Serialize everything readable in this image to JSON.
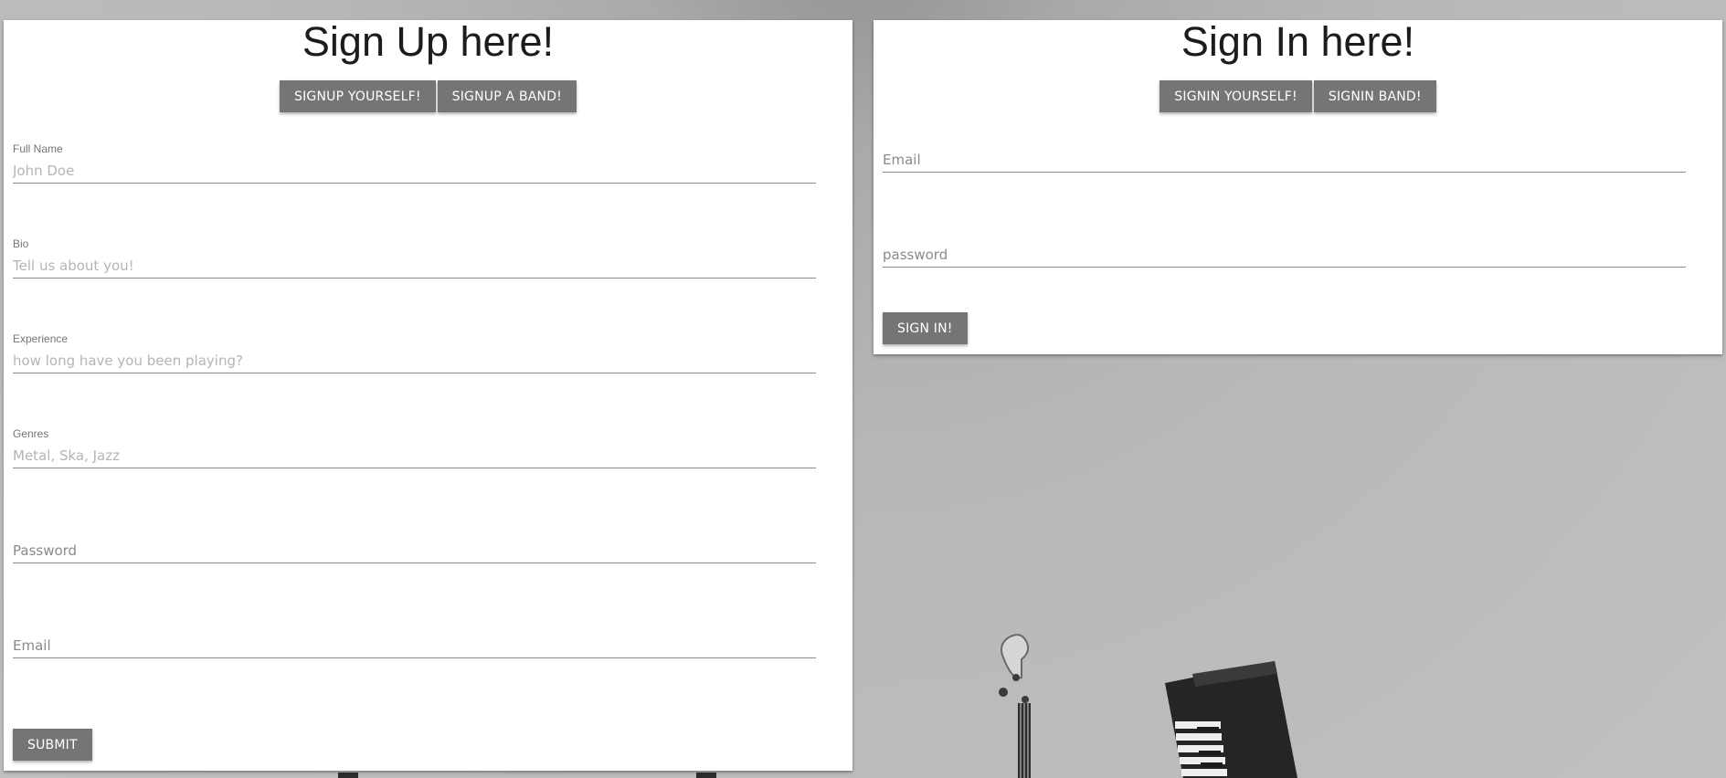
{
  "signup": {
    "title": "Sign Up here!",
    "buttons": {
      "yourself": "SIGNUP YOURSELF!",
      "band": "SIGNUP A BAND!"
    },
    "fields": [
      {
        "label": "Full Name",
        "placeholder": "John Doe"
      },
      {
        "label": "Bio",
        "placeholder": "Tell us about you!"
      },
      {
        "label": "Experience",
        "placeholder": "how long have you been playing?"
      },
      {
        "label": "Genres",
        "placeholder": "Metal, Ska, Jazz"
      },
      {
        "label": "",
        "placeholder": "Password"
      },
      {
        "label": "",
        "placeholder": "Email"
      }
    ],
    "submit": "SUBMIT"
  },
  "signin": {
    "title": "Sign In here!",
    "buttons": {
      "yourself": "SIGNIN YOURSELF!",
      "band": "SIGNIN BAND!"
    },
    "fields": [
      {
        "placeholder": "Email"
      },
      {
        "placeholder": "password"
      }
    ],
    "submit": "SIGN IN!"
  },
  "colors": {
    "button": "#757575",
    "card": "#ffffff",
    "background": "#b5b5b5"
  }
}
